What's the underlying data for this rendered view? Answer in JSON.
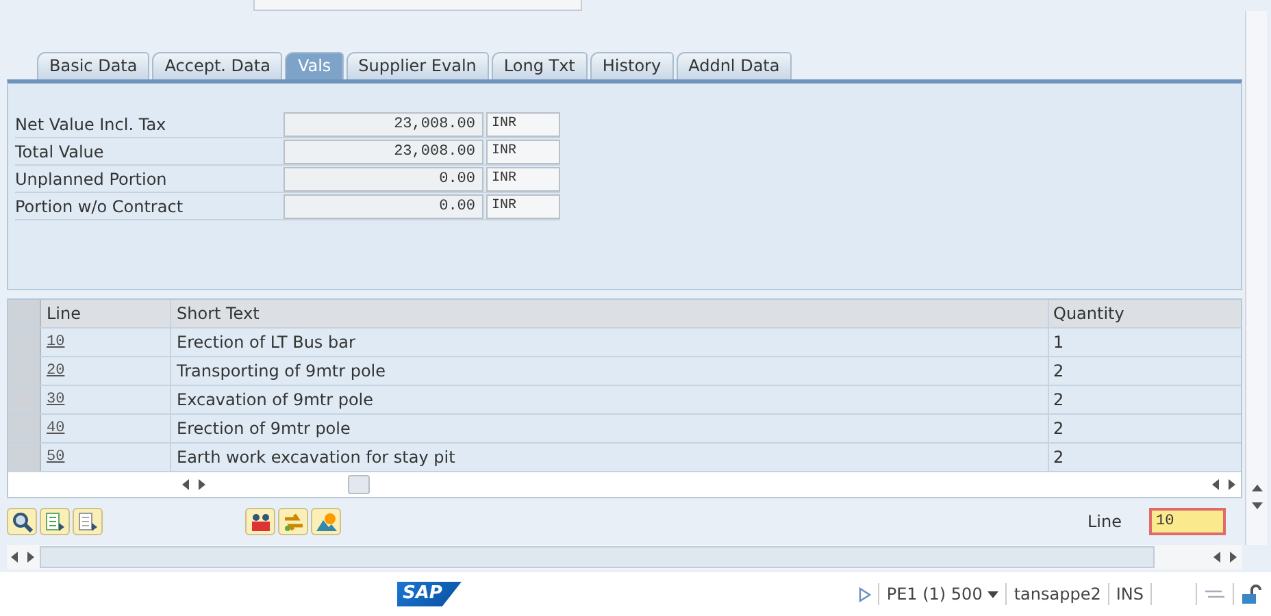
{
  "tabs": [
    {
      "label": "Basic Data",
      "selected": false
    },
    {
      "label": "Accept. Data",
      "selected": false
    },
    {
      "label": "Vals",
      "selected": true
    },
    {
      "label": "Supplier Evaln",
      "selected": false
    },
    {
      "label": "Long Txt",
      "selected": false
    },
    {
      "label": "History",
      "selected": false
    },
    {
      "label": "Addnl Data",
      "selected": false
    }
  ],
  "values": [
    {
      "label": "Net Value Incl. Tax",
      "amount": "23,008.00",
      "currency": "INR"
    },
    {
      "label": "Total Value",
      "amount": "23,008.00",
      "currency": "INR"
    },
    {
      "label": "Unplanned Portion",
      "amount": "0.00",
      "currency": "INR"
    },
    {
      "label": "Portion w/o Contract",
      "amount": "0.00",
      "currency": "INR"
    }
  ],
  "table": {
    "columns": [
      "Line",
      "Short Text",
      "Quantity"
    ],
    "rows": [
      {
        "line": "10",
        "short_text": "Erection of LT Bus bar",
        "quantity": "1"
      },
      {
        "line": "20",
        "short_text": "Transporting of 9mtr pole",
        "quantity": "2"
      },
      {
        "line": "30",
        "short_text": "Excavation of 9mtr pole",
        "quantity": "2"
      },
      {
        "line": "40",
        "short_text": "Erection of 9mtr pole",
        "quantity": "2"
      },
      {
        "line": "50",
        "short_text": "Earth work excavation for stay pit",
        "quantity": "2"
      }
    ]
  },
  "line_field": {
    "label": "Line",
    "value": "10"
  },
  "status_bar": {
    "logo": "SAP",
    "system": "PE1 (1) 500",
    "server": "tansappe2",
    "mode": "INS"
  }
}
